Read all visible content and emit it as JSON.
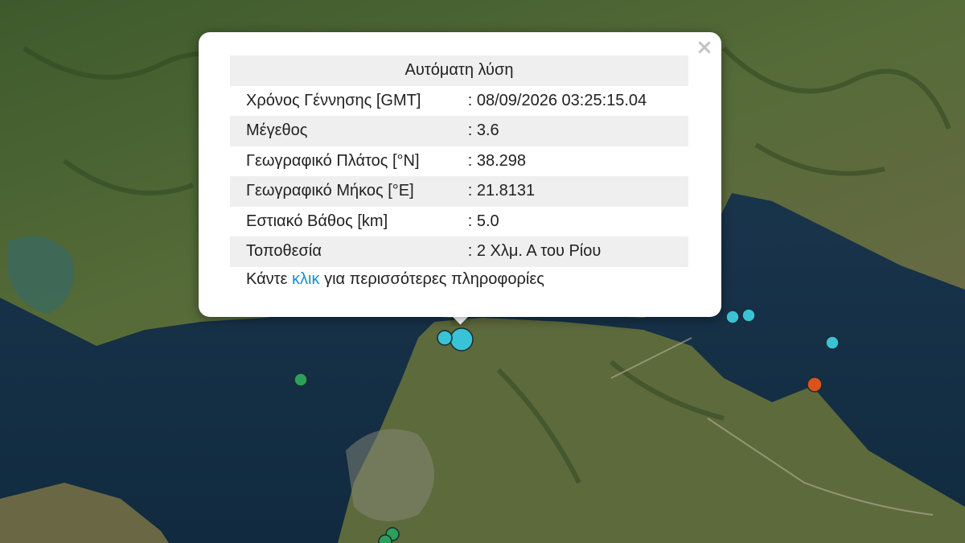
{
  "popup": {
    "title": "Αυτόματη λύση",
    "close_symbol": "×",
    "rows": [
      {
        "label": "Χρόνος Γέννησης [GMT]",
        "value": ": 08/09/2026 03:25:15.04"
      },
      {
        "label": "Μέγεθος",
        "value": ": 3.6"
      },
      {
        "label": "Γεωγραφικό Πλάτος [°N]",
        "value": ": 38.298"
      },
      {
        "label": "Γεωγραφικό Μήκος [°E]",
        "value": ": 21.8131"
      },
      {
        "label": "Εστιακό Βάθος [km]",
        "value": ": 5.0"
      },
      {
        "label": "Τοποθεσία",
        "value": ": 2 Χλμ. Α του Ρίου"
      }
    ],
    "more_prefix": "Κάντε",
    "more_link": "κλικ",
    "more_suffix": "για περισσότερες πληροφορίες"
  },
  "colors": {
    "title_red": "#e11919",
    "link_blue": "#1a8dc9",
    "marker_cyan": "#38c3d6",
    "marker_green": "#2ca05a",
    "marker_orange": "#d9541b",
    "sea": "#17324a",
    "land": "#4b5e33"
  },
  "markers": [
    {
      "name": "selected",
      "color": "#38c3d6"
    },
    {
      "name": "cyan",
      "color": "#38c3d6"
    },
    {
      "name": "cyan",
      "color": "#38c3d6"
    },
    {
      "name": "cyan",
      "color": "#38c3d6"
    },
    {
      "name": "cyan",
      "color": "#38c3d6"
    },
    {
      "name": "green",
      "color": "#2ca05a"
    },
    {
      "name": "green",
      "color": "#2ca05a"
    },
    {
      "name": "green",
      "color": "#2ca05a"
    },
    {
      "name": "orange",
      "color": "#d9541b"
    }
  ]
}
